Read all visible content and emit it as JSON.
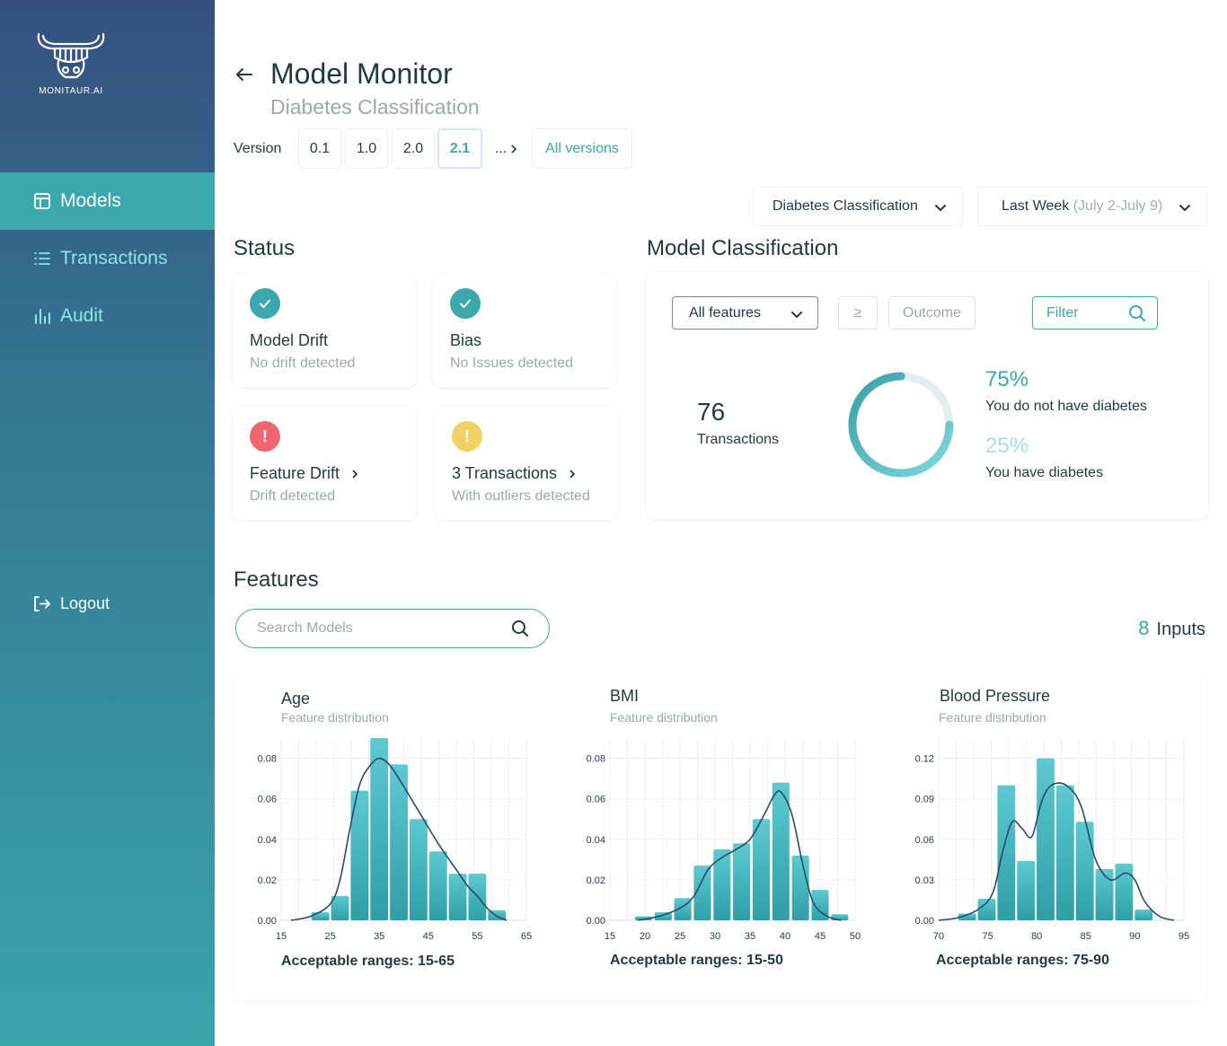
{
  "brand": {
    "name": "MONITAUR.AI"
  },
  "sidebar": {
    "items": [
      {
        "label": "Models",
        "icon": "layout-icon",
        "active": true
      },
      {
        "label": "Transactions",
        "icon": "list-icon",
        "active": false
      },
      {
        "label": "Audit",
        "icon": "bar-chart-icon",
        "active": false
      }
    ],
    "logout": "Logout"
  },
  "header": {
    "title": "Model Monitor",
    "subtitle": "Diabetes Classification",
    "version_label": "Version",
    "versions": [
      "0.1",
      "1.0",
      "2.0",
      "2.1"
    ],
    "active_version": "2.1",
    "more": "...",
    "all_versions": "All versions"
  },
  "filters": {
    "model": "Diabetes Classification",
    "period_label": "Last Week",
    "period_range": "(July 2-July 9)"
  },
  "status": {
    "title": "Status",
    "cards": [
      {
        "title": "Model Drift",
        "desc": "No drift detected",
        "state": "ok"
      },
      {
        "title": "Bias",
        "desc": "No Issues detected",
        "state": "ok"
      },
      {
        "title": "Feature Drift",
        "desc": "Drift detected",
        "state": "error"
      },
      {
        "title": "3 Transactions",
        "desc": "With outliers detected",
        "state": "warning"
      }
    ]
  },
  "classification": {
    "title": "Model Classification",
    "feature_select": "All features",
    "operator": "≥",
    "outcome_placeholder": "Outcome",
    "filter_placeholder": "Filter",
    "transactions_count": "76",
    "transactions_label": "Transactions",
    "donut_fraction": 0.75,
    "classes": [
      {
        "pct": "75%",
        "label": "You do not have diabetes"
      },
      {
        "pct": "25%",
        "label": "You have diabetes"
      }
    ]
  },
  "features": {
    "title": "Features",
    "search_placeholder": "Search Models",
    "inputs_count": "8",
    "inputs_label": "Inputs"
  },
  "colors": {
    "accent": "#3aa8ad",
    "ok": "#3aa8ad",
    "error": "#ef6671",
    "warning": "#efd263"
  },
  "chart_data": [
    {
      "type": "bar",
      "title": "Age",
      "subtitle": "Feature distribution",
      "range_label": "Acceptable ranges: 15-65",
      "x_ticks": [
        15,
        25,
        35,
        45,
        55,
        65
      ],
      "y_ticks": [
        "0.00",
        "0.02",
        "0.04",
        "0.06",
        "0.08"
      ],
      "xlim": [
        15,
        65
      ],
      "ylim": [
        0,
        0.09
      ],
      "bin_width": 4,
      "bins": [
        23,
        27,
        31,
        35,
        39,
        43,
        47,
        51,
        55,
        59
      ],
      "values": [
        0.004,
        0.012,
        0.064,
        0.09,
        0.077,
        0.05,
        0.034,
        0.023,
        0.023,
        0.005
      ],
      "kde_x": [
        17,
        21,
        25,
        27,
        29,
        31,
        33,
        35,
        37,
        39,
        43,
        47,
        51,
        53,
        55,
        57,
        59,
        61
      ],
      "kde_y": [
        0,
        0.002,
        0.008,
        0.02,
        0.045,
        0.067,
        0.076,
        0.08,
        0.077,
        0.07,
        0.054,
        0.038,
        0.024,
        0.017,
        0.012,
        0.006,
        0.002,
        0
      ],
      "grid": true
    },
    {
      "type": "bar",
      "title": "BMI",
      "subtitle": "Feature distribution",
      "range_label": "Acceptable ranges: 15-50",
      "x_ticks": [
        15,
        20,
        25,
        30,
        35,
        40,
        45,
        50
      ],
      "y_ticks": [
        "0.00",
        "0.02",
        "0.04",
        "0.06",
        "0.08"
      ],
      "xlim": [
        15,
        50
      ],
      "ylim": [
        0,
        0.09
      ],
      "bin_width": 2.7,
      "bins": [
        19.8,
        22.6,
        25.4,
        28.2,
        31.0,
        33.8,
        36.6,
        39.4,
        42.2,
        45.0,
        47.8
      ],
      "values": [
        0.002,
        0.004,
        0.011,
        0.027,
        0.035,
        0.038,
        0.05,
        0.068,
        0.032,
        0.015,
        0.003
      ],
      "kde_x": [
        19,
        22,
        25,
        27,
        29,
        31,
        33,
        35,
        37,
        38.5,
        39.5,
        41,
        42.5,
        44,
        46,
        48
      ],
      "kde_y": [
        0,
        0.002,
        0.006,
        0.012,
        0.025,
        0.031,
        0.035,
        0.04,
        0.052,
        0.062,
        0.063,
        0.052,
        0.028,
        0.009,
        0.002,
        0
      ],
      "grid": true
    },
    {
      "type": "bar",
      "title": "Blood Pressure",
      "subtitle": "Feature distribution",
      "range_label": "Acceptable ranges: 75-90",
      "x_ticks": [
        70,
        75,
        80,
        85,
        90,
        95
      ],
      "y_ticks": [
        "0.00",
        "0.03",
        "0.06",
        "0.09",
        "0.12"
      ],
      "xlim": [
        70,
        95
      ],
      "ylim": [
        0,
        0.135
      ],
      "bin_width": 2,
      "bins": [
        72.9,
        74.9,
        76.9,
        78.9,
        80.9,
        82.9,
        84.9,
        86.9,
        88.9,
        90.9
      ],
      "values": [
        0.005,
        0.016,
        0.1,
        0.044,
        0.12,
        0.1,
        0.073,
        0.038,
        0.042,
        0.008
      ],
      "kde_x": [
        70,
        72,
        74,
        75.5,
        76.5,
        77.5,
        78.5,
        79.5,
        80.5,
        81.5,
        83,
        84.5,
        86,
        87.5,
        89,
        90,
        91,
        92.5,
        94
      ],
      "kde_y": [
        0,
        0.002,
        0.008,
        0.02,
        0.05,
        0.073,
        0.068,
        0.062,
        0.088,
        0.1,
        0.1,
        0.085,
        0.045,
        0.03,
        0.035,
        0.03,
        0.014,
        0.003,
        0
      ],
      "grid": true
    }
  ]
}
